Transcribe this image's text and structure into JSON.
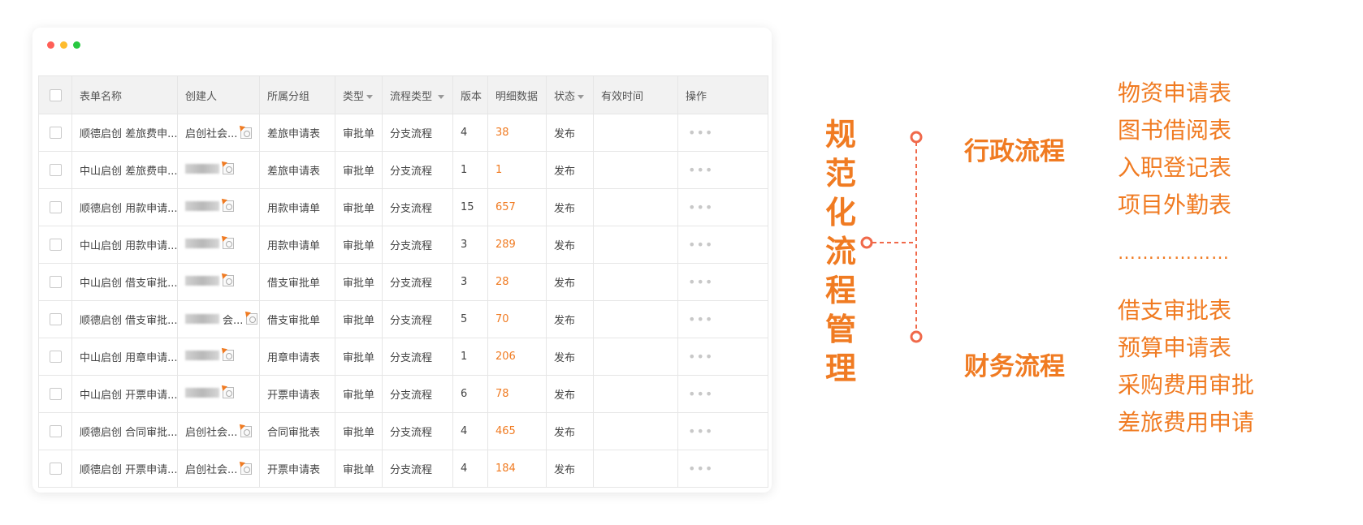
{
  "table": {
    "headers": {
      "name": "表单名称",
      "creator": "创建人",
      "group": "所属分组",
      "type": "类型",
      "flow_type": "流程类型",
      "version": "版本",
      "detail": "明细数据",
      "status": "状态",
      "valid_time": "有效时间",
      "ops": "操作"
    },
    "ops_glyph": "•••",
    "rows": [
      {
        "name": "顺德启创 差旅费申...",
        "creator": "启创社会...",
        "creator_blurred": false,
        "group": "差旅申请表",
        "type": "审批单",
        "flow_type": "分支流程",
        "version": "4",
        "detail": "38",
        "status": "发布"
      },
      {
        "name": "中山启创 差旅费申...",
        "creator": "",
        "creator_blurred": true,
        "group": "差旅申请表",
        "type": "审批单",
        "flow_type": "分支流程",
        "version": "1",
        "detail": "1",
        "status": "发布"
      },
      {
        "name": "顺德启创 用款申请...",
        "creator": "",
        "creator_blurred": true,
        "group": "用款申请单",
        "type": "审批单",
        "flow_type": "分支流程",
        "version": "15",
        "detail": "657",
        "status": "发布"
      },
      {
        "name": "中山启创 用款申请...",
        "creator": "",
        "creator_blurred": true,
        "group": "用款申请单",
        "type": "审批单",
        "flow_type": "分支流程",
        "version": "3",
        "detail": "289",
        "status": "发布"
      },
      {
        "name": "中山启创 借支审批...",
        "creator": "",
        "creator_blurred": true,
        "group": "借支审批单",
        "type": "审批单",
        "flow_type": "分支流程",
        "version": "3",
        "detail": "28",
        "status": "发布"
      },
      {
        "name": "顺德启创 借支审批...",
        "creator": "会...",
        "creator_blurred": true,
        "group": "借支审批单",
        "type": "审批单",
        "flow_type": "分支流程",
        "version": "5",
        "detail": "70",
        "status": "发布"
      },
      {
        "name": "中山启创 用章申请...",
        "creator": "",
        "creator_blurred": true,
        "group": "用章申请表",
        "type": "审批单",
        "flow_type": "分支流程",
        "version": "1",
        "detail": "206",
        "status": "发布"
      },
      {
        "name": "中山启创 开票申请...",
        "creator": "",
        "creator_blurred": true,
        "group": "开票申请表",
        "type": "审批单",
        "flow_type": "分支流程",
        "version": "6",
        "detail": "78",
        "status": "发布"
      },
      {
        "name": "顺德启创 合同审批...",
        "creator": "启创社会...",
        "creator_blurred": false,
        "group": "合同审批表",
        "type": "审批单",
        "flow_type": "分支流程",
        "version": "4",
        "detail": "465",
        "status": "发布"
      },
      {
        "name": "顺德启创 开票申请...",
        "creator": "启创社会...",
        "creator_blurred": false,
        "group": "开票申请表",
        "type": "审批单",
        "flow_type": "分支流程",
        "version": "4",
        "detail": "184",
        "status": "发布"
      }
    ]
  },
  "diagram": {
    "title_chars": [
      "规",
      "范",
      "化",
      "流",
      "程",
      "管",
      "理"
    ],
    "branches": {
      "admin": {
        "label": "行政流程",
        "items": [
          "物资申请表",
          "图书借阅表",
          "入职登记表",
          "项目外勤表"
        ]
      },
      "finance": {
        "label": "财务流程",
        "items": [
          "借支审批表",
          "预算申请表",
          "采购费用审批",
          "差旅费用申请"
        ]
      },
      "ellipsis": "………………"
    },
    "accent_color": "#f07b22",
    "line_color": "#f0694a"
  }
}
